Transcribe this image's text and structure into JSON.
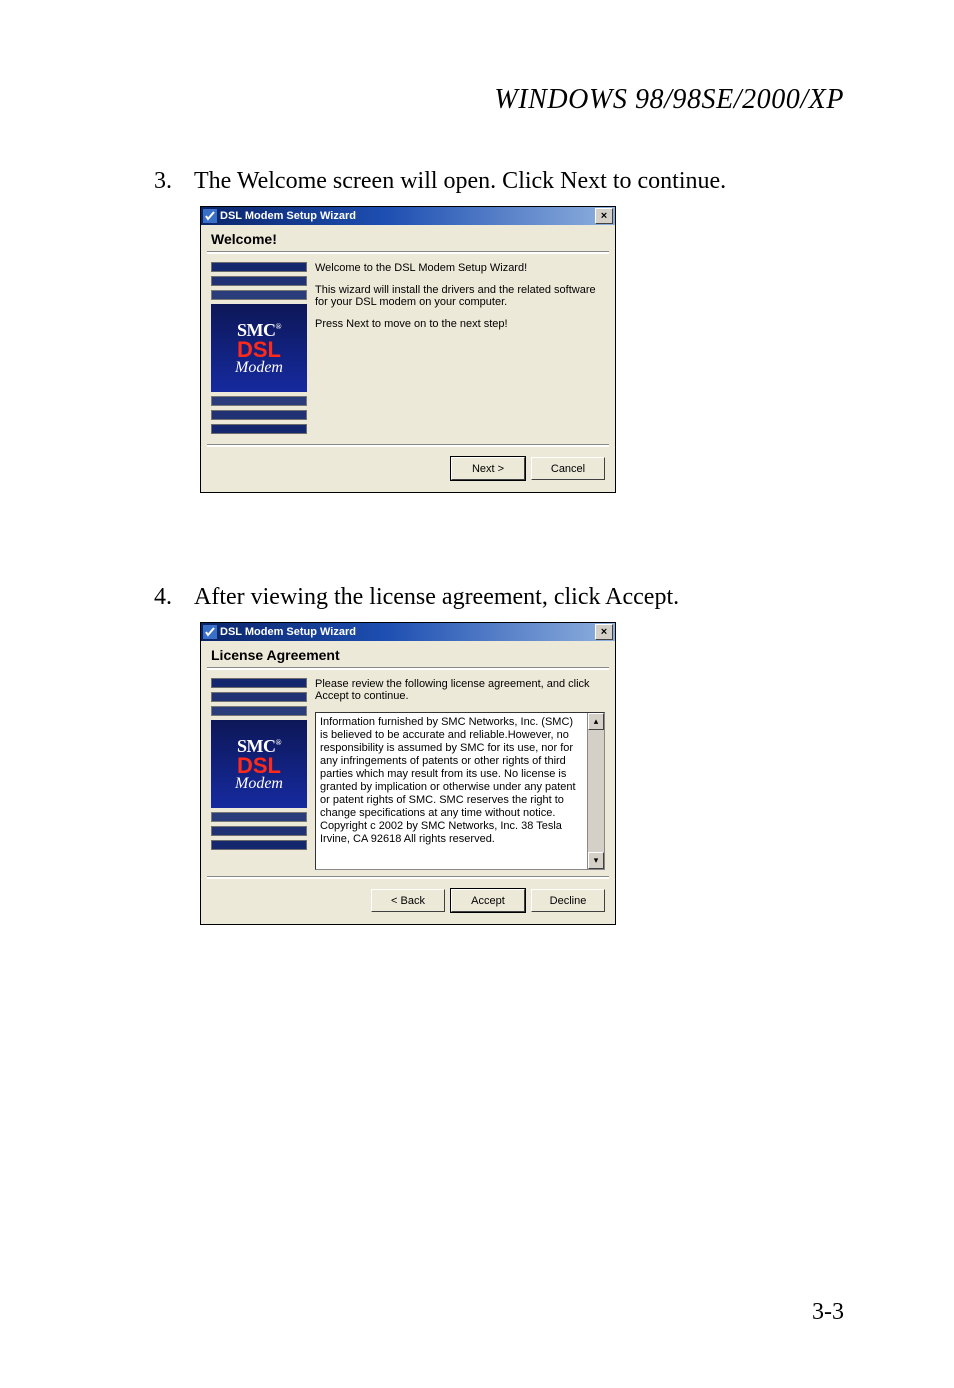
{
  "header": "WINDOWS 98/98SE/2000/XP",
  "step3": {
    "num": "3.",
    "text": "The Welcome screen will open. Click Next to continue."
  },
  "step4": {
    "num": "4.",
    "text": "After viewing the license agreement, click Accept."
  },
  "page_number": "3-3",
  "brand": {
    "smc": "SMC",
    "reg": "®",
    "dsl": "DSL",
    "modem": "Modem"
  },
  "dlg1": {
    "title": "DSL Modem Setup Wizard",
    "heading": "Welcome!",
    "p1": "Welcome to the DSL Modem Setup Wizard!",
    "p2": "This wizard will install the drivers and the related software for your DSL modem on your computer.",
    "p3": "Press Next to move on to the next step!",
    "next": "Next >",
    "cancel": "Cancel",
    "close": "×"
  },
  "dlg2": {
    "title": "DSL Modem Setup Wizard",
    "heading": "License Agreement",
    "intro": "Please review the following license agreement, and click Accept to continue.",
    "license": "Information furnished by SMC Networks, Inc. (SMC) is believed to be accurate and reliable.However, no responsibility is assumed by SMC for its use, nor for any infringements of patents or other rights of third parties which may result from its use. No license is granted by implication or otherwise under any patent or patent rights of SMC. SMC reserves the right to change specifications at any time without notice.  Copyright c 2002 by SMC Networks, Inc. 38 Tesla Irvine, CA 92618  All rights reserved.",
    "back": "< Back",
    "accept": "Accept",
    "decline": "Decline",
    "close": "×",
    "scroll_up": "▴",
    "scroll_down": "▾"
  }
}
